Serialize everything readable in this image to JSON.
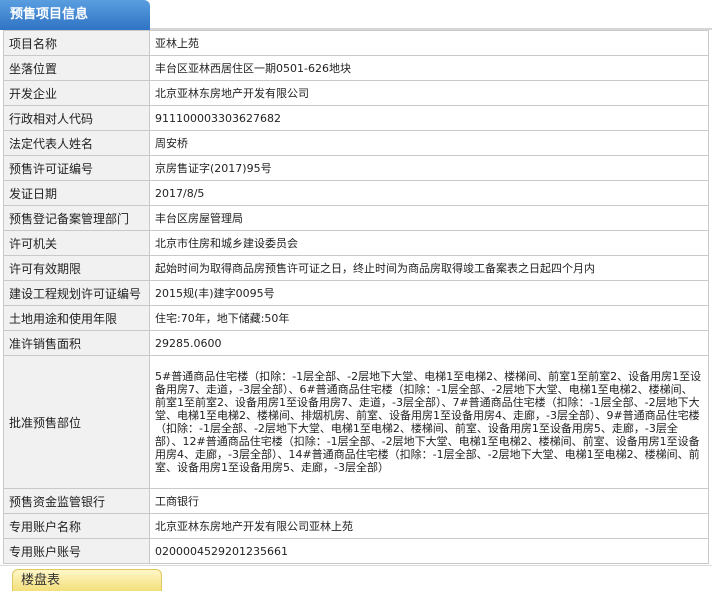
{
  "header": {
    "title": "预售项目信息"
  },
  "rows": [
    {
      "label": "项目名称",
      "value": "亚林上苑"
    },
    {
      "label": "坐落位置",
      "value": "丰台区亚林西居住区一期0501-626地块"
    },
    {
      "label": "开发企业",
      "value": "北京亚林东房地产开发有限公司"
    },
    {
      "label": "行政相对人代码",
      "value": "911100003303627682"
    },
    {
      "label": "法定代表人姓名",
      "value": "周安桥"
    },
    {
      "label": "预售许可证编号",
      "value": "京房售证字(2017)95号"
    },
    {
      "label": "发证日期",
      "value": "2017/8/5"
    },
    {
      "label": "预售登记备案管理部门",
      "value": "丰台区房屋管理局"
    },
    {
      "label": "许可机关",
      "value": "北京市住房和城乡建设委员会"
    },
    {
      "label": "许可有效期限",
      "value": "起始时间为取得商品房预售许可证之日，终止时间为商品房取得竣工备案表之日起四个月内"
    },
    {
      "label": "建设工程规划许可证编号",
      "value": "2015规(丰)建字0095号"
    },
    {
      "label": "土地用途和使用年限",
      "value": "住宅:70年，地下储藏:50年"
    },
    {
      "label": "准许销售面积",
      "value": "29285.0600"
    },
    {
      "label": "批准预售部位",
      "value": "5#普通商品住宅楼（扣除：-1层全部、-2层地下大堂、电梯1至电梯2、楼梯间、前室1至前室2、设备用房1至设备用房7、走道，-3层全部）、6#普通商品住宅楼（扣除：-1层全部、-2层地下大堂、电梯1至电梯2、楼梯间、前室1至前室2、设备用房1至设备用房7、走道，-3层全部）、7#普通商品住宅楼（扣除：-1层全部、-2层地下大堂、电梯1至电梯2、楼梯间、排烟机房、前室、设备用房1至设备用房4、走廊，-3层全部）、9#普通商品住宅楼（扣除：-1层全部、-2层地下大堂、电梯1至电梯2、楼梯间、前室、设备用房1至设备用房5、走廊，-3层全部）、12#普通商品住宅楼（扣除：-1层全部、-2层地下大堂、电梯1至电梯2、楼梯间、前室、设备用房1至设备用房4、走廊，-3层全部）、14#普通商品住宅楼（扣除：-1层全部、-2层地下大堂、电梯1至电梯2、楼梯间、前室、设备用房1至设备用房5、走廊，-3层全部）"
    },
    {
      "label": "预售资金监管银行",
      "value": "工商银行"
    },
    {
      "label": "专用账户名称",
      "value": "北京亚林东房地产开发有限公司亚林上苑"
    },
    {
      "label": "专用账户账号",
      "value": "0200004529201235661"
    }
  ],
  "footer": {
    "tab": "楼盘表"
  }
}
